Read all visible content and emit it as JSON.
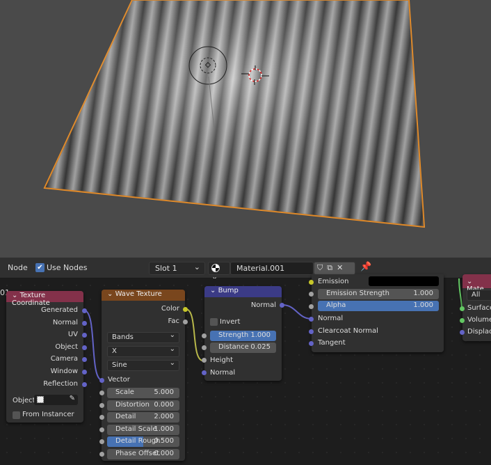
{
  "header": {
    "editor_type": "Node",
    "use_nodes_label": "Use Nodes",
    "use_nodes_checked": true,
    "slot": "Slot 1",
    "material_name": "Material.001",
    "left_edge_label": "01"
  },
  "nodes": {
    "texture_coordinate": {
      "title": "Texture Coordinate",
      "color": "#83314a",
      "outputs": [
        "Generated",
        "Normal",
        "UV",
        "Object",
        "Camera",
        "Window",
        "Reflection"
      ],
      "object_label": "Object:",
      "from_instancer": "From Instancer"
    },
    "wave_texture": {
      "title": "Wave Texture",
      "color": "#79461d",
      "outputs": [
        "Color",
        "Fac"
      ],
      "wave_type": "Bands",
      "direction": "X",
      "profile": "Sine",
      "vector_label": "Vector",
      "fields": [
        {
          "label": "Scale",
          "value": "5.000"
        },
        {
          "label": "Distortion",
          "value": "0.000"
        },
        {
          "label": "Detail",
          "value": "2.000"
        },
        {
          "label": "Detail Scale",
          "value": "1.000"
        },
        {
          "label": "Detail Rough",
          "value": "0.500",
          "fill": 0.5
        },
        {
          "label": "Phase Offset",
          "value": "0.000"
        }
      ]
    },
    "bump": {
      "title": "Bump",
      "color": "#3b3b86",
      "output": "Normal",
      "invert": "Invert",
      "strength_label": "Strength",
      "strength": "1.000",
      "distance_label": "Distance",
      "distance": "0.025",
      "height": "Height",
      "normal": "Normal"
    },
    "principled": {
      "emission": "Emission",
      "emission_color": "#000000",
      "emission_strength_label": "Emission Strength",
      "emission_strength": "1.000",
      "alpha_label": "Alpha",
      "alpha": "1.000",
      "normal": "Normal",
      "clearcoat_normal": "Clearcoat Normal",
      "tangent": "Tangent"
    },
    "material_output": {
      "title": "Mate",
      "target": "All",
      "inputs": [
        "Surface",
        "Volume",
        "Displace"
      ]
    }
  }
}
